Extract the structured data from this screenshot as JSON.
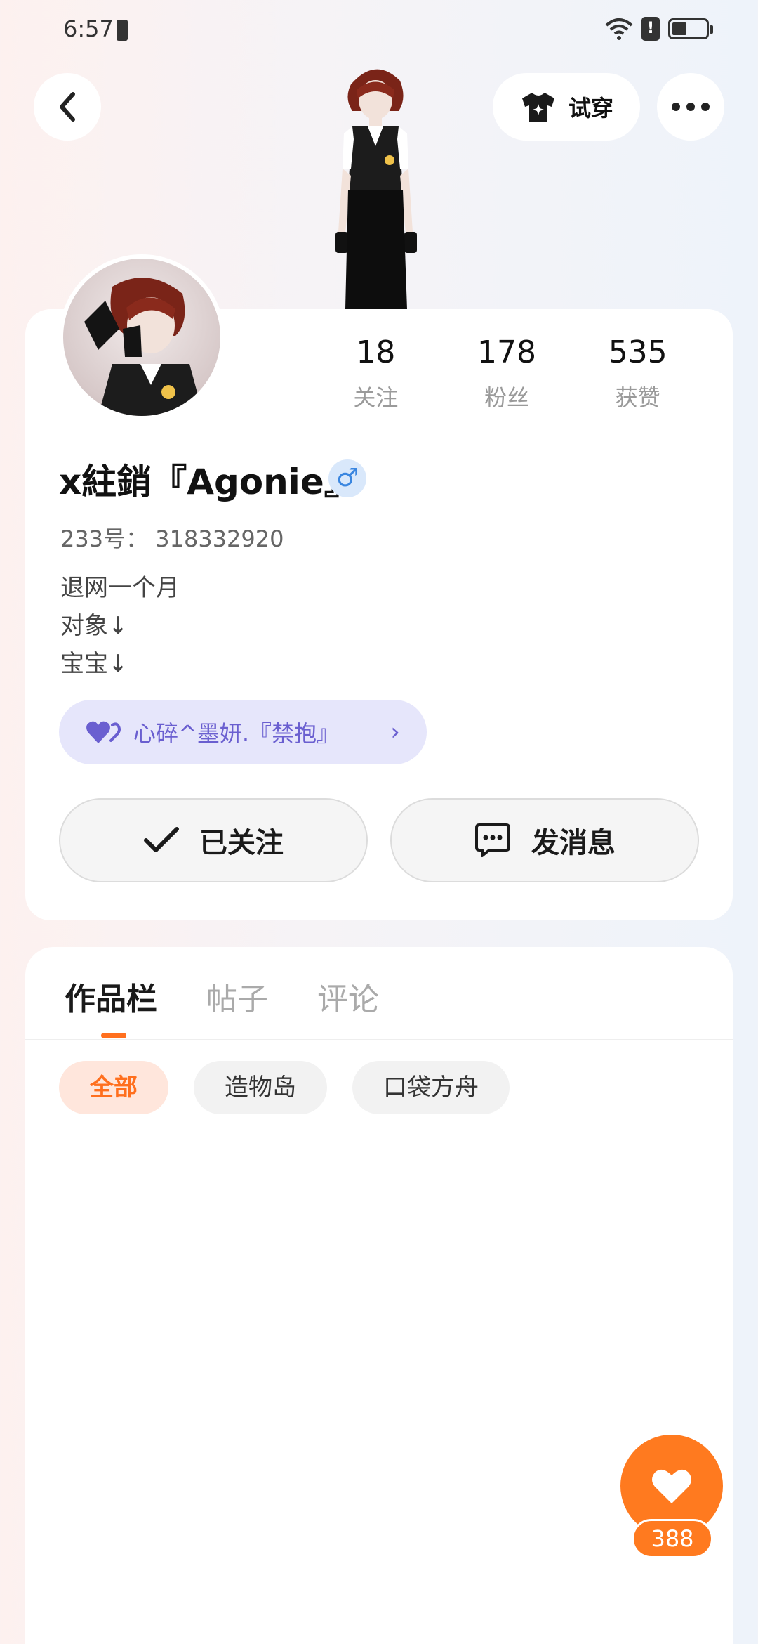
{
  "status_bar": {
    "time": "6:57"
  },
  "header": {
    "try_on_label": "试穿"
  },
  "profile": {
    "stats": [
      {
        "value": "18",
        "label": "关注"
      },
      {
        "value": "178",
        "label": "粉丝"
      },
      {
        "value": "535",
        "label": "获赞"
      }
    ],
    "username": "x紸銷『Agonie』",
    "gender_symbol": "♂",
    "uid": "233号：  318332920",
    "bio": [
      "退网一个月",
      "对象↓",
      "宝宝↓"
    ],
    "cp_name": "心碎^墨妍.『禁抱』"
  },
  "actions": {
    "follow_label": "已关注",
    "message_label": "发消息"
  },
  "tabs": [
    "作品栏",
    "帖子",
    "评论"
  ],
  "chips": [
    "全部",
    "造物岛",
    "口袋方舟"
  ],
  "like": {
    "count": "388"
  },
  "colors": {
    "accent": "#ff7a1f",
    "cp_purple": "#6a5fd0"
  }
}
